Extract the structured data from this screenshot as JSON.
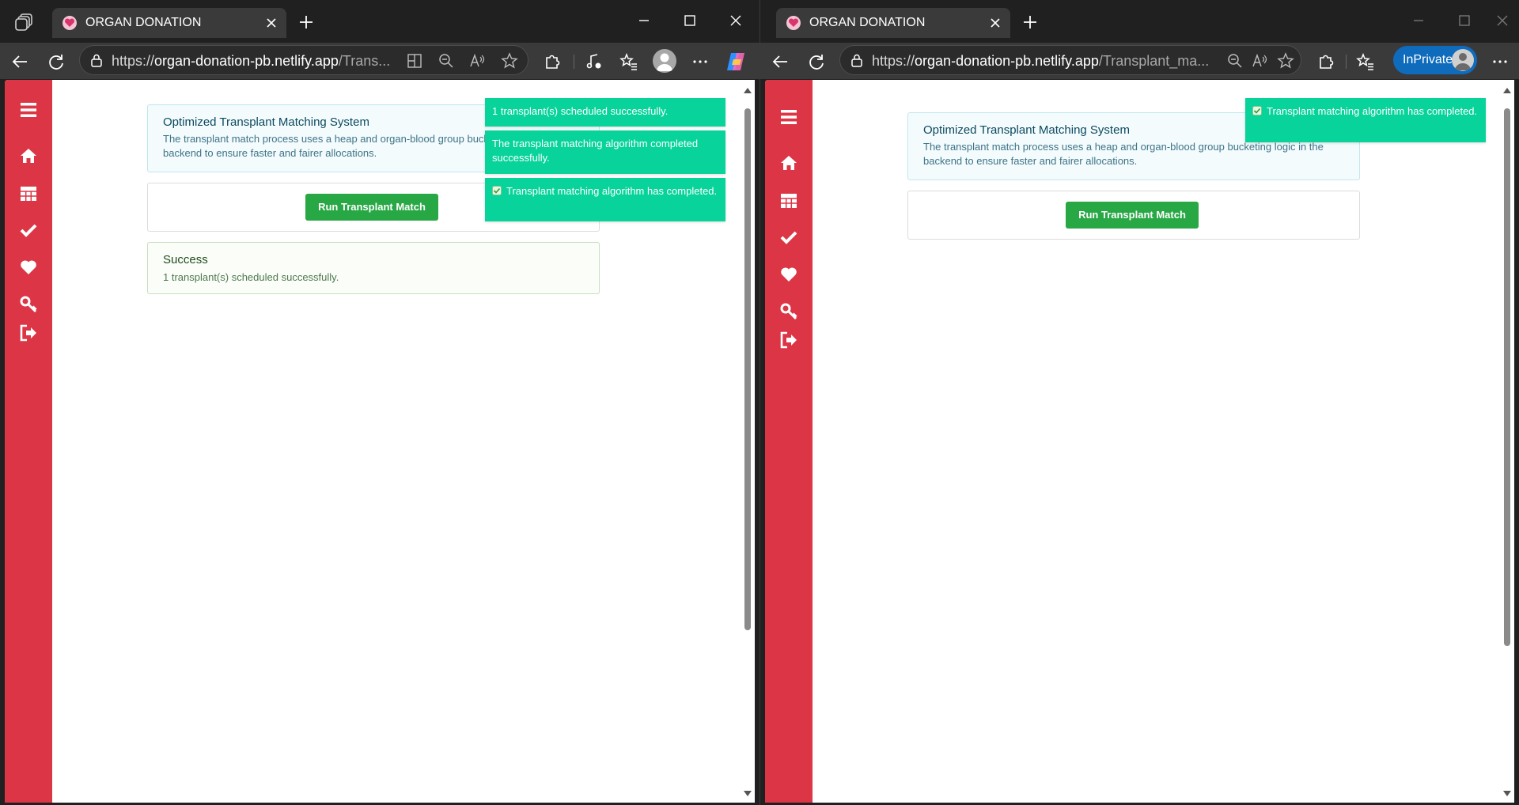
{
  "colors": {
    "sidebar": "#dc3545",
    "toast": "#07d39a",
    "run_button": "#28a745",
    "inprivate": "#0f6cbd"
  },
  "windows": {
    "left": {
      "tab": {
        "title": "ORGAN DONATION"
      },
      "address": {
        "host": "organ-donation-pb.netlify.app",
        "scheme": "https://",
        "path": "/Trans..."
      },
      "page": {
        "info_title": "Optimized Transplant Matching System",
        "info_desc": "The transplant match process uses a heap and organ-blood group bucketing logic in the backend to ensure faster and fairer allocations.",
        "run_button": "Run Transplant Match",
        "success_title": "Success",
        "success_msg": "1 transplant(s) scheduled successfully."
      },
      "toasts": [
        "1 transplant(s) scheduled successfully.",
        "The transplant matching algorithm completed successfully.",
        "Transplant matching algorithm has completed."
      ]
    },
    "right": {
      "tab": {
        "title": "ORGAN DONATION"
      },
      "address": {
        "host": "organ-donation-pb.netlify.app",
        "scheme": "https://",
        "path": "/Transplant_ma..."
      },
      "inprivate_label": "InPrivate",
      "page": {
        "info_title": "Optimized Transplant Matching System",
        "info_desc": "The transplant match process uses a heap and organ-blood group bucketing logic in the backend to ensure faster and fairer allocations.",
        "run_button": "Run Transplant Match"
      },
      "toasts": [
        "Transplant matching algorithm has completed."
      ]
    }
  },
  "icons": {
    "tabbar": [
      "workspaces-icon",
      "favicon-icon",
      "close-icon",
      "new-tab-icon",
      "minimize-icon",
      "maximize-icon",
      "window-close-icon"
    ],
    "toolbar": [
      "back-icon",
      "refresh-icon",
      "lock-icon",
      "split-screen-icon",
      "zoom-out-icon",
      "read-aloud-icon",
      "favorite-star-icon",
      "extensions-icon",
      "media-icon",
      "favorites-icon",
      "profile-icon",
      "more-icon",
      "copilot-icon"
    ],
    "sidebar": [
      "menu-icon",
      "home-icon",
      "table-icon",
      "check-icon",
      "heart-icon",
      "key-icon",
      "logout-icon"
    ]
  }
}
